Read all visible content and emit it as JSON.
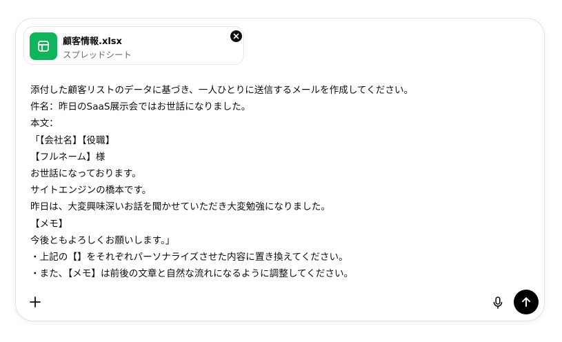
{
  "attachment": {
    "file_name": "顧客情報.xlsx",
    "file_type": "スプレッドシート",
    "icon": "spreadsheet-icon",
    "icon_color": "#10b45a",
    "remove_icon": "close-icon"
  },
  "message": {
    "lines": [
      "添付した顧客リストのデータに基づき、一人ひとりに送信するメールを作成してください。",
      "件名：昨日のSaaS展示会ではお世話になりました。",
      "本文：",
      "「【会社名】【役職】",
      "【フルネーム】様",
      "お世話になっております。",
      "サイトエンジンの橋本です。",
      "昨日は、大変興味深いお話を聞かせていただき大変勉強になりました。",
      "【メモ】",
      "今後ともよろしくお願いします。」",
      "・上記の【】をそれぞれパーソナライズさせた内容に置き換えてください。",
      "・また、【メモ】は前後の文章と自然な流れになるように調整してください。"
    ]
  },
  "toolbar": {
    "add_icon": "plus-icon",
    "mic_icon": "microphone-icon",
    "send_icon": "arrow-up-icon",
    "send_color": "#000000"
  }
}
